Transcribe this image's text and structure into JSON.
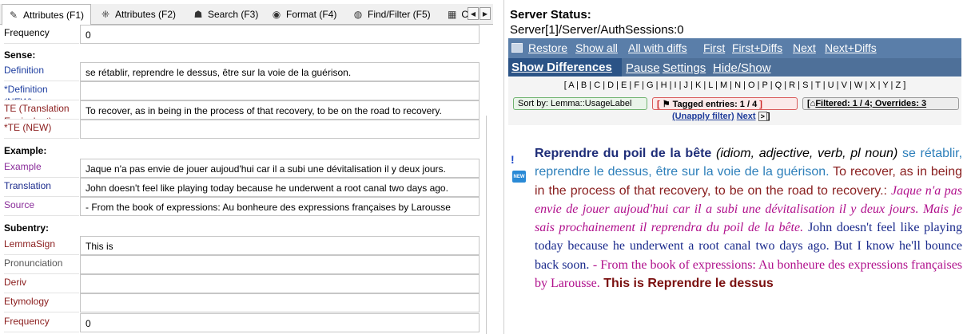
{
  "tabs": [
    {
      "label": "Attributes (F1)",
      "icon": "edit-icon",
      "active": true
    },
    {
      "label": "Attributes (F2)",
      "icon": "grid-icon",
      "active": false
    },
    {
      "label": "Search (F3)",
      "icon": "binoculars-icon",
      "active": false
    },
    {
      "label": "Format (F4)",
      "icon": "eye-icon",
      "active": false
    },
    {
      "label": "Find/Filter (F5)",
      "icon": "filter-icon",
      "active": false
    },
    {
      "label": "C",
      "icon": "table-icon",
      "active": false
    }
  ],
  "form": {
    "frequency_top": {
      "label": "Frequency",
      "value": "0"
    },
    "sense_header": "Sense:",
    "definition": {
      "label": "Definition",
      "value": "se rétablir, reprendre le dessus, être sur la voie de la guérison."
    },
    "definition_new": {
      "label": "*Definition (NEW)",
      "value": ""
    },
    "te": {
      "label": "TE (Translation Equivalent)",
      "value": "To recover, as in being in the process of that recovery, to be on the road to recovery."
    },
    "te_new": {
      "label": "*TE (NEW)",
      "value": ""
    },
    "example_header": "Example:",
    "example": {
      "label": "Example",
      "value": "Jaque n'a pas envie de jouer aujoud'hui car il a subi une dévitalisation il y deux jours."
    },
    "translation": {
      "label": "Translation",
      "value": "John doesn't feel like playing today because he underwent a root canal two days ago."
    },
    "source": {
      "label": "Source",
      "value": "- From the book of expressions: Au bonheure des expressions françaises by Larousse"
    },
    "subentry_header": "Subentry:",
    "lemmasign": {
      "label": "LemmaSign",
      "value": "This is"
    },
    "pronunciation": {
      "label": "Pronunciation",
      "value": ""
    },
    "deriv": {
      "label": "Deriv",
      "value": ""
    },
    "etymology": {
      "label": "Etymology",
      "value": ""
    },
    "frequency_bottom": {
      "label": "Frequency",
      "value": "0"
    }
  },
  "server": {
    "title": "Server Status:",
    "path": "Server[1]/Server/AuthSessions:0",
    "toolbar_row1": [
      "Restore",
      "Show all",
      "All with diffs",
      "First",
      "First+Diffs",
      "Next",
      "Next+Diffs"
    ],
    "toolbar_row2": [
      "Show Differences",
      "Pause",
      "Settings",
      "Hide/Show"
    ],
    "alphabet": "[ A | B | C | D | E | F | G | H | I | J | K | L | M | N | O | P | Q | R | S | T | U | V | W | X | Y | Z ]",
    "sort_chip": "Sort by: Lemma::UsageLabel",
    "tagged_chip": "Tagged entries: 1 / 4",
    "filter_chip": "Filtered: 1 / 4; Overrides: 3",
    "unapply": "(Unapply filter)",
    "next": "Next"
  },
  "entry": {
    "marker": "!",
    "badge": "NEW",
    "headword": "Reprendre du poil de la bête",
    "pos": "(idiom, adjective, verb, pl noun)",
    "definition": "se rétablir, reprendre le dessus, être sur la voie de la guérison.",
    "te": "To recover, as in being in the process of that recovery, to be on the road to recovery.:",
    "example": "Jaque n'a pas envie de jouer aujoud'hui car il a subi une dévitalisation il y deux jours. Mais je sais prochainement il reprendra du poil de la bête.",
    "translation": "John doesn't feel like playing today because he underwent a root canal two days ago. But I know he'll bounce back soon.",
    "source": "- From the book of expressions: Au bonheure des expressions françaises by Larousse.",
    "subentry": "This is Reprendre le dessus"
  },
  "colors": {
    "toolbar_bg": "#5a7ea9",
    "toolbar_active": "#2b5386",
    "label_red": "#8a1c1c",
    "label_blue": "#1f3fa0",
    "label_purple": "#8a2d9a"
  }
}
